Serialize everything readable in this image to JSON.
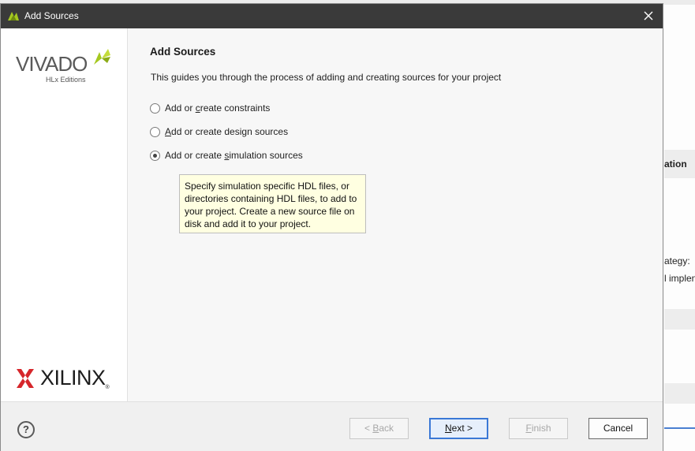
{
  "window": {
    "title": "Add Sources"
  },
  "sidebar": {
    "vivado_logo_text": "VIVADO",
    "vivado_sub": "HLx Editions",
    "xilinx_logo_text": "XILINX",
    "xilinx_reg": "®"
  },
  "main": {
    "heading": "Add Sources",
    "description": "This guides you through the process of adding and creating sources for your project",
    "options": [
      {
        "prefix": "Add or ",
        "mnemonic": "c",
        "suffix": "reate constraints",
        "checked": false
      },
      {
        "prefix": "",
        "mnemonic": "A",
        "suffix": "dd or create design sources",
        "checked": false
      },
      {
        "prefix": "Add or create ",
        "mnemonic": "s",
        "suffix": "imulation sources",
        "checked": true
      }
    ],
    "tooltip": "Specify simulation specific HDL files, or directories containing HDL files, to add to your project. Create a new source file on disk and add it to your project."
  },
  "footer": {
    "help": "?",
    "back": {
      "pre": "< ",
      "mn": "B",
      "post": "ack"
    },
    "next": {
      "pre": "",
      "mn": "N",
      "post": "ext >"
    },
    "finish": {
      "pre": "",
      "mn": "F",
      "post": "inish"
    },
    "cancel": "Cancel"
  },
  "background": {
    "frag1": "ation",
    "frag2": "ategy:",
    "frag3": "l implen"
  },
  "colors": {
    "titlebar": "#3a3a3a",
    "accent": "#3a78d6",
    "tooltip_bg": "#ffffe1",
    "vivado_leaf": "#a5c820"
  }
}
